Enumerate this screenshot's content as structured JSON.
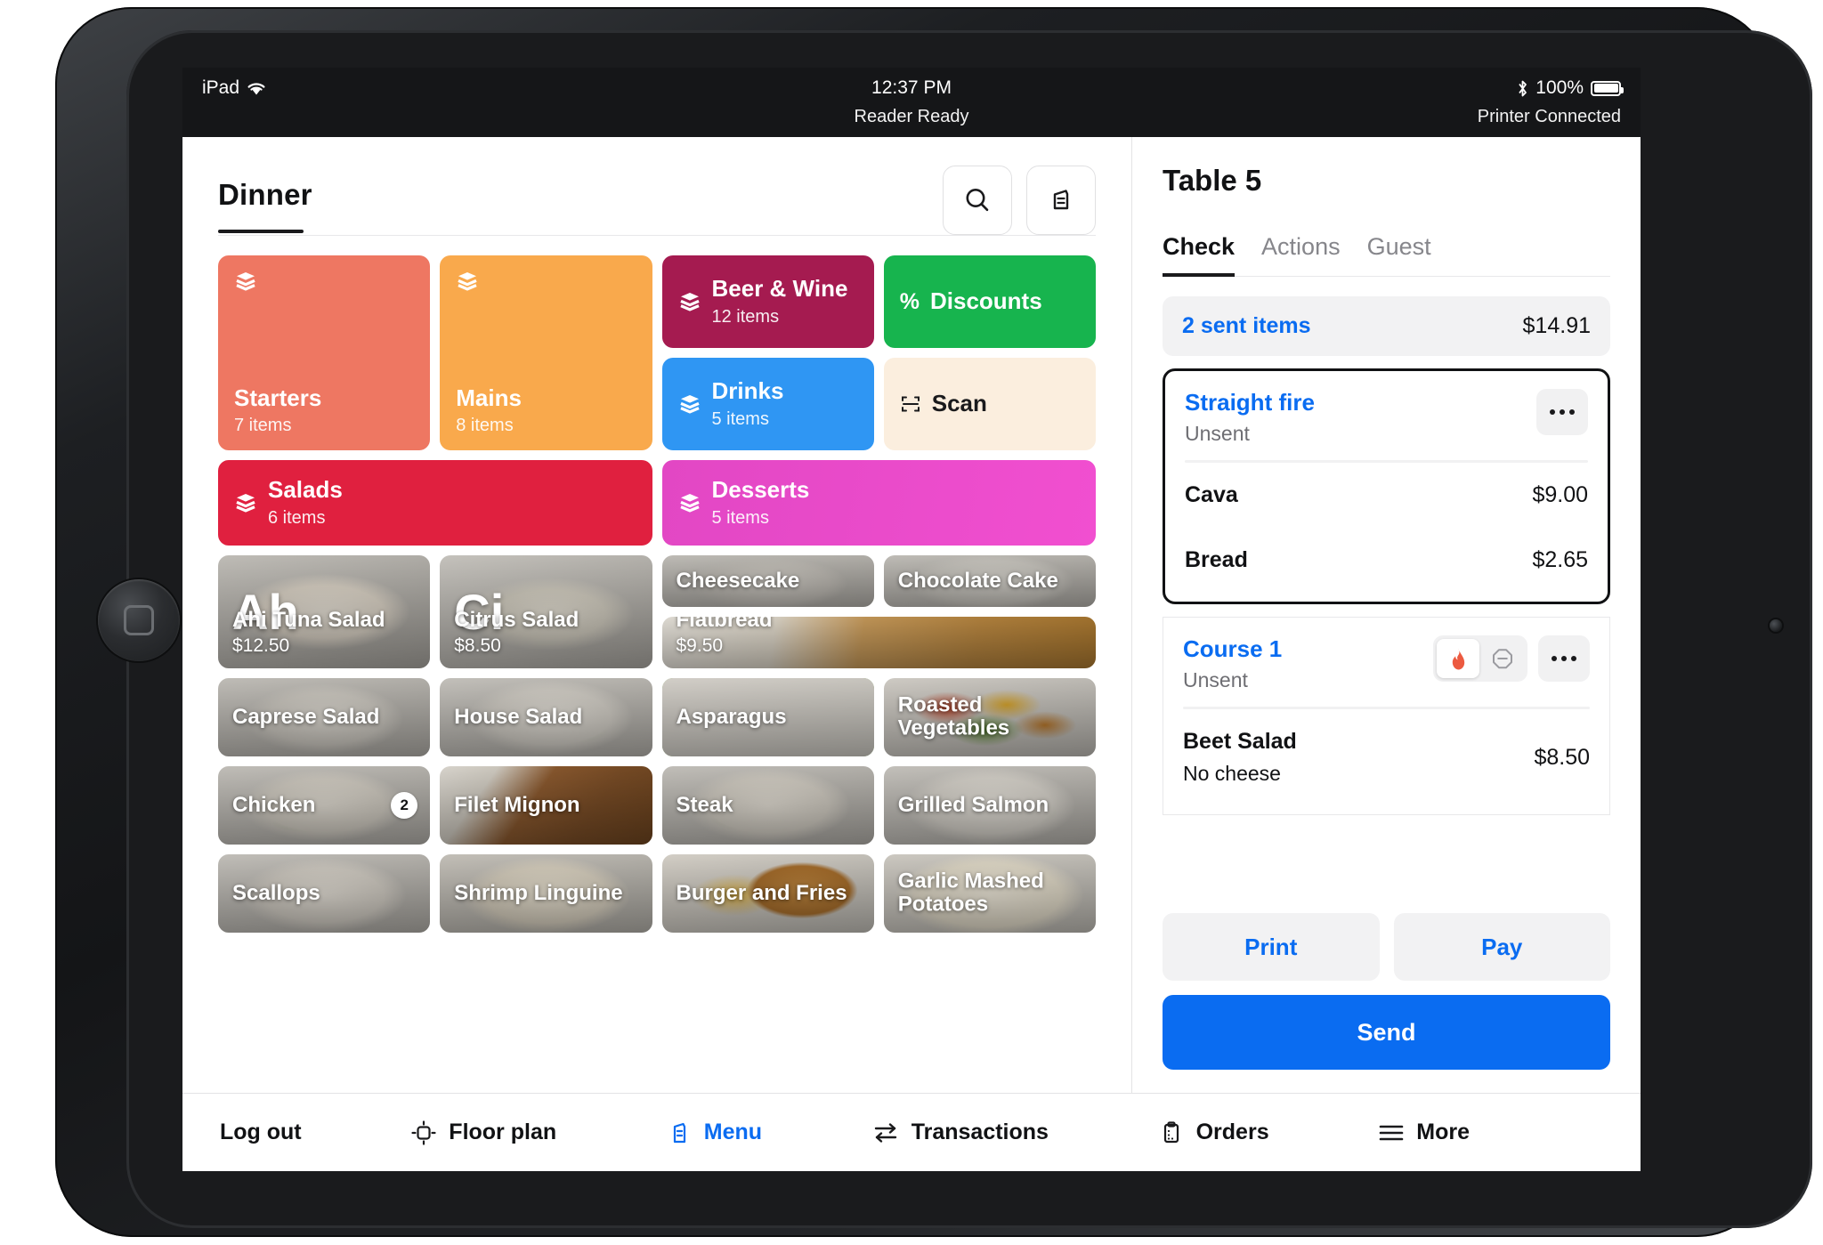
{
  "status_bar": {
    "device_label": "iPad",
    "wifi_icon": "wifi-icon",
    "clock": "12:37 PM",
    "bluetooth_icon": "bluetooth-icon",
    "battery_percent": "100%",
    "reader_status": "Reader Ready",
    "printer_status": "Printer Connected"
  },
  "menu": {
    "title": "Dinner",
    "search_icon": "search-icon",
    "receipt_icon": "receipt-icon",
    "categories": [
      {
        "name": "Starters",
        "count": "7 items",
        "color": "#EE7762",
        "layout": "tall"
      },
      {
        "name": "Mains",
        "count": "8 items",
        "color": "#F9A94C",
        "layout": "tall"
      },
      {
        "name": "Beer & Wine",
        "count": "12 items",
        "color": "#A51B50",
        "layout": "inline"
      },
      {
        "name": "Discounts",
        "count": "",
        "color": "#17B44E",
        "layout": "action",
        "icon": "percent-icon"
      },
      {
        "name": "Drinks",
        "count": "5 items",
        "color": "#2F96F3",
        "layout": "inline"
      },
      {
        "name": "Scan",
        "count": "",
        "color": "#FBEEDE",
        "layout": "action",
        "icon": "scan-icon",
        "text_color": "#1a1a1c"
      },
      {
        "name": "Salads",
        "count": "6 items",
        "color": "#E0203F",
        "layout": "wide"
      },
      {
        "name": "Desserts",
        "count": "5 items",
        "color": "#EA4CC5",
        "layout": "wide"
      }
    ],
    "items": [
      {
        "name": "Ahi Tuna Salad",
        "price": "$12.50",
        "initials": "Ah",
        "span": "tall",
        "photo": "ahi-tuna-salad-photo"
      },
      {
        "name": "Citrus Salad",
        "price": "$8.50",
        "initials": "Ci",
        "span": "tall",
        "photo": "citrus-salad-photo"
      },
      {
        "name": "Cheesecake",
        "price": "",
        "span": "small",
        "photo": "cheesecake-photo"
      },
      {
        "name": "Chocolate Cake",
        "price": "",
        "span": "small",
        "photo": "chocolate-cake-photo"
      },
      {
        "name": "Flatbread",
        "price": "$9.50",
        "span": "wide",
        "photo": "flatbread-photo"
      },
      {
        "name": "Caprese Salad",
        "price": "",
        "span": "small",
        "photo": "caprese-salad-photo"
      },
      {
        "name": "House Salad",
        "price": "",
        "span": "small",
        "photo": "house-salad-photo"
      },
      {
        "name": "Asparagus",
        "price": "",
        "span": "small",
        "photo": "asparagus-photo"
      },
      {
        "name": "Roasted Vegetables",
        "price": "",
        "span": "small",
        "photo": "roasted-vegetables-photo"
      },
      {
        "name": "Chicken",
        "price": "",
        "span": "small",
        "photo": "chicken-photo",
        "qty": "2"
      },
      {
        "name": "Filet Mignon",
        "price": "",
        "span": "small",
        "photo": "filet-mignon-photo"
      },
      {
        "name": "Steak",
        "price": "",
        "span": "small",
        "photo": "steak-photo"
      },
      {
        "name": "Grilled Salmon",
        "price": "",
        "span": "small",
        "photo": "grilled-salmon-photo"
      },
      {
        "name": "Scallops",
        "price": "",
        "span": "small",
        "photo": "scallops-photo"
      },
      {
        "name": "Shrimp Linguine",
        "price": "",
        "span": "small",
        "photo": "shrimp-linguine-photo"
      },
      {
        "name": "Burger and Fries",
        "price": "",
        "span": "small",
        "photo": "burger-and-fries-photo"
      },
      {
        "name": "Garlic Mashed Potatoes",
        "price": "",
        "span": "small",
        "photo": "garlic-mashed-potatoes-photo"
      }
    ]
  },
  "check": {
    "table_title": "Table 5",
    "tabs": [
      {
        "label": "Check",
        "active": true
      },
      {
        "label": "Actions",
        "active": false
      },
      {
        "label": "Guest",
        "active": false
      }
    ],
    "sent_items_label": "2 sent items",
    "sent_items_amount": "$14.91",
    "courses": [
      {
        "name": "Straight fire",
        "status": "Unsent",
        "selected": true,
        "more_icon": "ellipsis-icon",
        "line_items": [
          {
            "name": "Cava",
            "modifier": "",
            "price": "$9.00"
          },
          {
            "name": "Bread",
            "modifier": "",
            "price": "$2.65"
          }
        ]
      },
      {
        "name": "Course 1",
        "status": "Unsent",
        "selected": false,
        "fire_icon": "fire-icon",
        "hold_icon": "hold-icon",
        "more_icon": "ellipsis-icon",
        "line_items": [
          {
            "name": "Beet Salad",
            "modifier": "No cheese",
            "price": "$8.50"
          }
        ]
      }
    ],
    "print_label": "Print",
    "pay_label": "Pay",
    "send_label": "Send"
  },
  "bottom_nav": [
    {
      "label": "Log out",
      "icon": "",
      "active": false
    },
    {
      "label": "Floor plan",
      "icon": "floorplan-icon",
      "active": false
    },
    {
      "label": "Menu",
      "icon": "menu-book-icon",
      "active": true
    },
    {
      "label": "Transactions",
      "icon": "transfer-icon",
      "active": false
    },
    {
      "label": "Orders",
      "icon": "orders-icon",
      "active": false
    },
    {
      "label": "More",
      "icon": "hamburger-icon",
      "active": false
    }
  ],
  "colors": {
    "accent_blue": "#0a6cf1",
    "text_primary": "#111214",
    "text_secondary": "#6e6e73",
    "panel_gray": "#f2f2f3"
  }
}
